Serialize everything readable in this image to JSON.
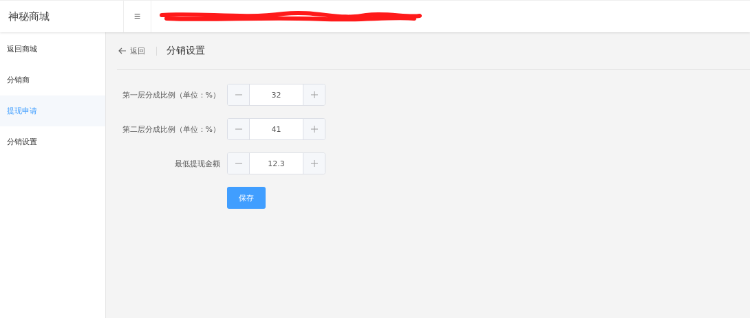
{
  "header": {
    "logo": "神秘商城",
    "menu_icon": "≡"
  },
  "sidebar": {
    "items": [
      {
        "label": "返回商城",
        "selected": false
      },
      {
        "label": "分销商",
        "selected": false
      },
      {
        "label": "提现申请",
        "selected": true
      },
      {
        "label": "分销设置",
        "selected": false
      }
    ]
  },
  "breadcrumb": {
    "back": "返回",
    "title": "分销设置"
  },
  "form": {
    "fields": [
      {
        "label": "第一层分成比例（单位：%）",
        "value": "32"
      },
      {
        "label": "第二层分成比例（单位：%）",
        "value": "41"
      },
      {
        "label": "最低提现金额",
        "value": "12.3"
      }
    ],
    "button": "保存"
  }
}
